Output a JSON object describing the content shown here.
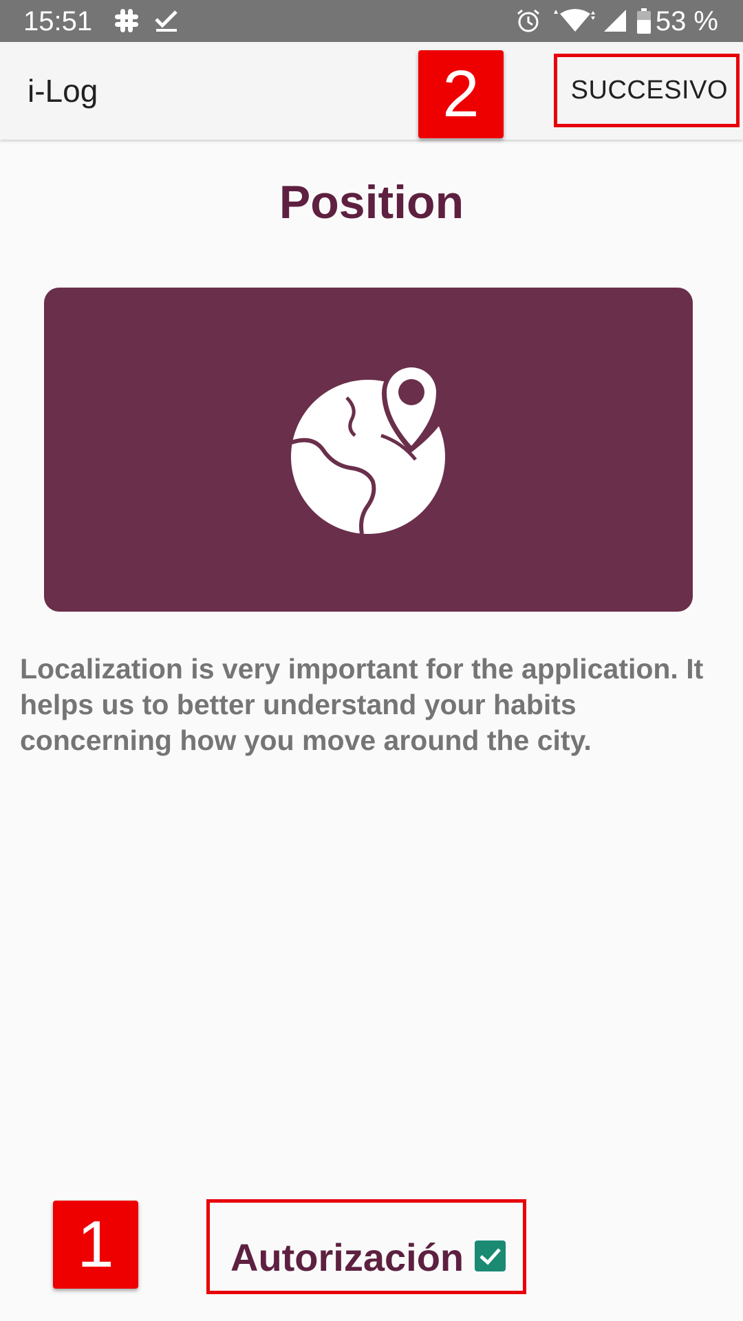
{
  "status_bar": {
    "time": "15:51",
    "battery": "53 %",
    "icons": [
      "slack-icon",
      "checkmark-icon",
      "alarm-icon",
      "wifi-icon",
      "signal-icon",
      "battery-icon"
    ]
  },
  "app_bar": {
    "title": "i-Log",
    "next_label": "SUCCESIVO"
  },
  "markers": {
    "one": "1",
    "two": "2"
  },
  "page": {
    "title": "Position",
    "hero_icon": "globe-location-pin-icon",
    "description": "Localization is very important for the application. It helps us to better understand your habits concerning how you move around the city."
  },
  "authorization": {
    "label": "Autorización",
    "checked": true
  },
  "colors": {
    "accent": "#5e2040",
    "card": "#6a2f4b",
    "checkbox": "#1a8a73",
    "highlight": "#e8000b"
  }
}
